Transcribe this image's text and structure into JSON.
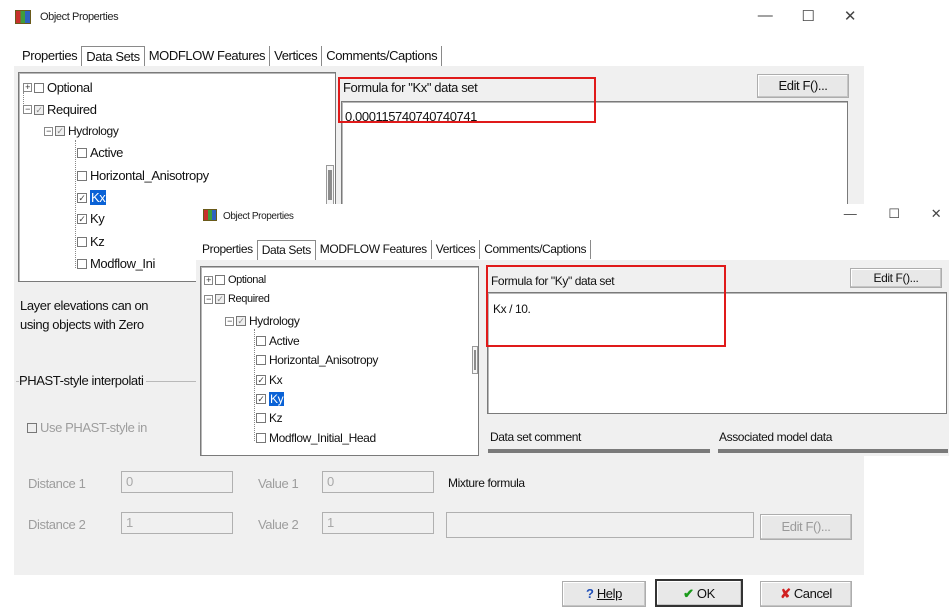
{
  "back_window": {
    "title": "Object Properties",
    "controls": {
      "minimize": "—",
      "maximize": "☐",
      "close": "✕"
    },
    "tabs": [
      "Properties",
      "Data Sets",
      "MODFLOW Features",
      "Vertices",
      "Comments/Captions"
    ],
    "tree": {
      "optional": "Optional",
      "required": "Required",
      "hydrology": "Hydrology",
      "items": [
        "Active",
        "Horizontal_Anisotropy",
        "Kx",
        "Ky",
        "Kz",
        "Modflow_Ini"
      ]
    },
    "formula_label": "Formula for \"Kx\" data set",
    "edit_button": "Edit F()...",
    "formula_value": "0.000115740740740741",
    "info_text_1": "Layer elevations can on",
    "info_text_2": "using objects with Zero",
    "phast_group": "PHAST-style interpolati",
    "phast_checkbox": "Use PHAST-style in",
    "distance1_label": "Distance 1",
    "distance1_value": "0",
    "value1_label": "Value 1",
    "value1_value": "0",
    "mixture_label": "Mixture formula",
    "distance2_label": "Distance 2",
    "distance2_value": "1",
    "value2_label": "Value 2",
    "value2_value": "1",
    "edit_button_2": "Edit F()...",
    "help_button": "Help",
    "ok_button": "OK",
    "cancel_button": "Cancel"
  },
  "front_window": {
    "title": "Object Properties",
    "controls": {
      "minimize": "—",
      "maximize": "☐",
      "close": "✕"
    },
    "tabs": [
      "Properties",
      "Data Sets",
      "MODFLOW Features",
      "Vertices",
      "Comments/Captions"
    ],
    "tree": {
      "optional": "Optional",
      "required": "Required",
      "hydrology": "Hydrology",
      "items": [
        "Active",
        "Horizontal_Anisotropy",
        "Kx",
        "Ky",
        "Kz",
        "Modflow_Initial_Head"
      ]
    },
    "formula_label": "Formula for \"Ky\" data set",
    "edit_button": "Edit F()...",
    "formula_value": "Kx / 10.",
    "data_set_comment": "Data set comment",
    "associated_model_data": "Associated model data"
  },
  "colors": {
    "highlight": "#0a62d6",
    "annotation": "#e01a1a",
    "ok_check": "#1a9a1a",
    "cancel_x": "#d02020"
  }
}
